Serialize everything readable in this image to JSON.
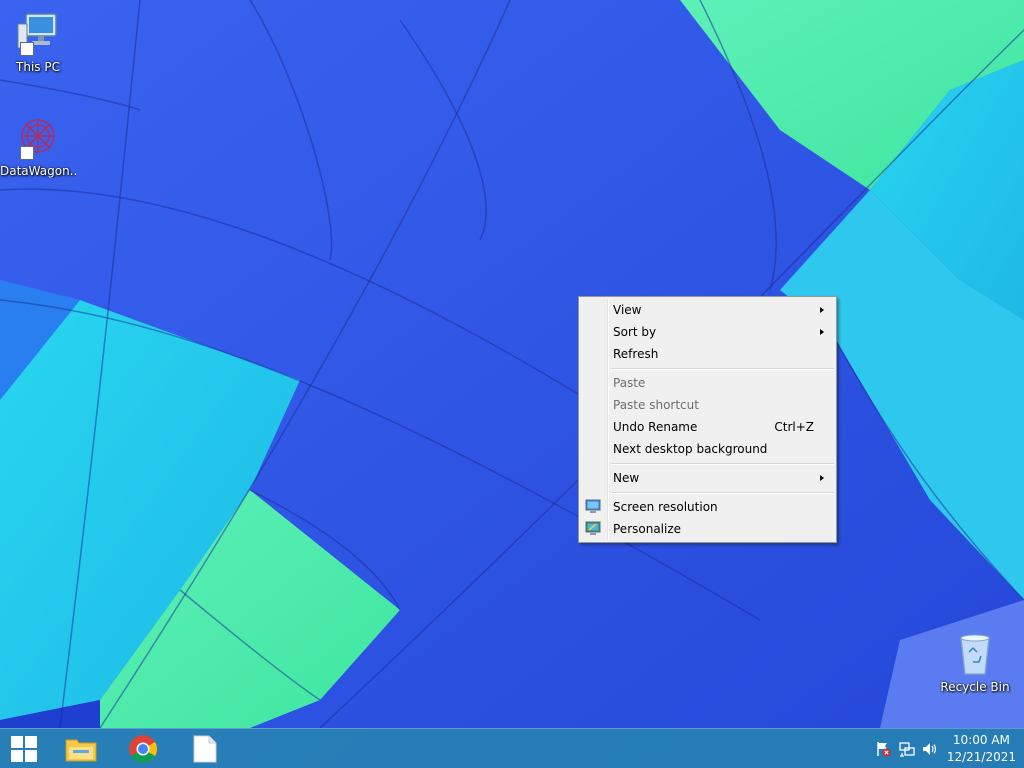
{
  "desktop": {
    "icons": [
      {
        "label": "This PC"
      },
      {
        "label": "DataWagon..."
      },
      {
        "label": "Recycle Bin"
      }
    ]
  },
  "context_menu": {
    "view": "View",
    "sort_by": "Sort by",
    "refresh": "Refresh",
    "paste": "Paste",
    "paste_shortcut": "Paste shortcut",
    "undo_rename": "Undo Rename",
    "undo_shortcut": "Ctrl+Z",
    "next_background": "Next desktop background",
    "new": "New",
    "screen_resolution": "Screen resolution",
    "personalize": "Personalize"
  },
  "taskbar": {
    "clock_time": "10:00 AM",
    "clock_date": "12/21/2021"
  },
  "colors": {
    "menu_background": "#f0f0f0",
    "taskbar": "#268caa"
  }
}
